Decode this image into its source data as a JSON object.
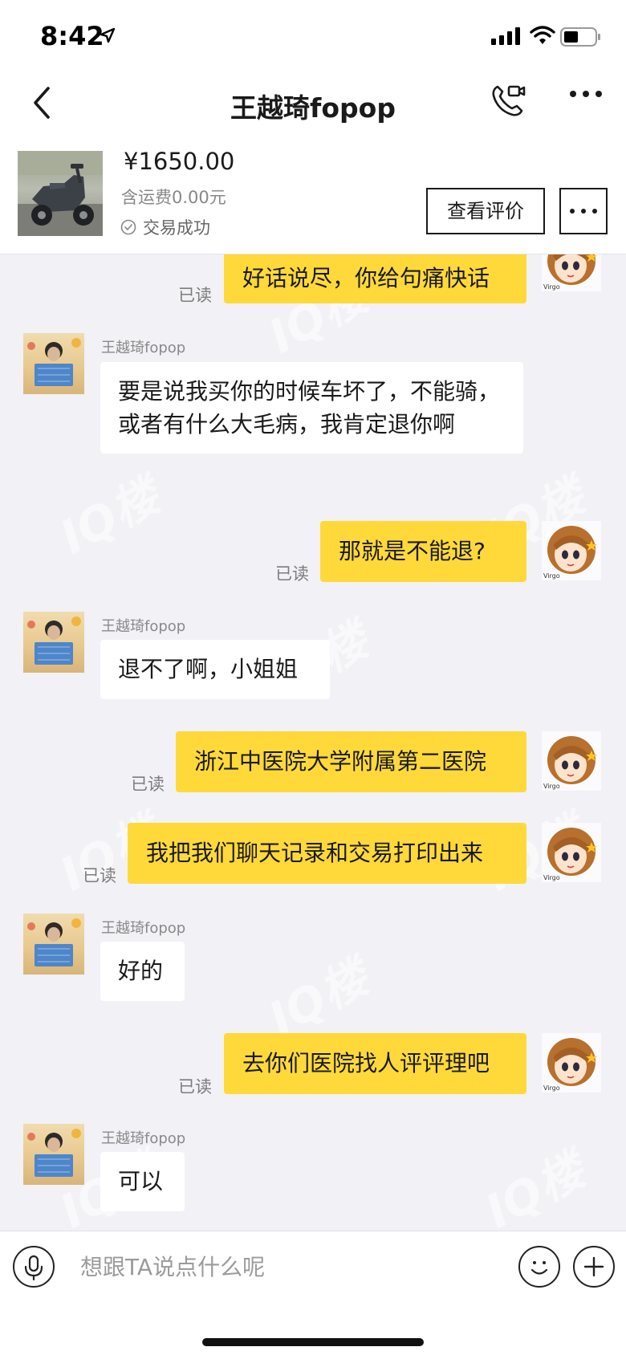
{
  "status_bar": {
    "time": "8:42",
    "icons": [
      "location-arrow-icon",
      "cellular-signal-icon",
      "wifi-icon",
      "battery-icon"
    ]
  },
  "nav": {
    "title": "王越琦fopop",
    "icons": [
      "back-icon",
      "video-call-icon",
      "more-icon"
    ]
  },
  "product": {
    "price": "¥1650.00",
    "shipping": "含运费0.00元",
    "status": "交易成功",
    "review_button": "查看评价",
    "more_button_icon": "more-icon"
  },
  "chat": {
    "contact_name": "王越琦fopop",
    "read_label": "已读",
    "messages": [
      {
        "from": "me",
        "text": "好话说尽，你给句痛快话",
        "read": true
      },
      {
        "from": "contact",
        "text": "要是说我买你的时候车坏了，不能骑，或者有什么大毛病，我肯定退你啊"
      },
      {
        "from": "me",
        "text": "那就是不能退?",
        "read": true
      },
      {
        "from": "contact",
        "text": "退不了啊，小姐姐"
      },
      {
        "from": "me",
        "text": "浙江中医院大学附属第二医院",
        "read": true
      },
      {
        "from": "me",
        "text": "我把我们聊天记录和交易打印出来",
        "read": true
      },
      {
        "from": "contact",
        "text": "好的"
      },
      {
        "from": "me",
        "text": "去你们医院找人评评理吧",
        "read": true
      },
      {
        "from": "contact",
        "text": "可以"
      }
    ],
    "avatar_caption": "Virgo"
  },
  "input_bar": {
    "placeholder": "想跟TA说点什么呢",
    "icons": [
      "microphone-icon",
      "emoji-icon",
      "plus-icon"
    ]
  },
  "colors": {
    "sent_bubble": "#ffd93a",
    "received_bubble": "#ffffff",
    "chat_background": "#f1f1f6"
  }
}
